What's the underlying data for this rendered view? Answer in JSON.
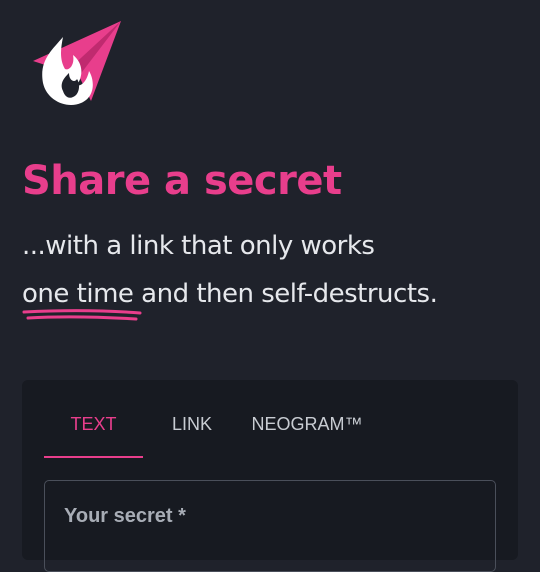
{
  "logo": {
    "icon": "paper-plane-flame-logo",
    "colors": {
      "plane": "#e83e8c",
      "flame": "#ffffff"
    }
  },
  "hero": {
    "title": "Share a secret",
    "subtitle_line1": "...with a link that only works",
    "subtitle_emphasis": "one time",
    "subtitle_line2_rest": " and then self-destructs."
  },
  "tabs": [
    {
      "label": "TEXT",
      "active": true
    },
    {
      "label": "LINK",
      "active": false
    },
    {
      "label": "NEOGRAM™",
      "active": false
    }
  ],
  "form": {
    "secret_label": "Your secret *"
  },
  "colors": {
    "accent": "#e83e8c",
    "background": "#1f222b",
    "card": "#171a21"
  }
}
